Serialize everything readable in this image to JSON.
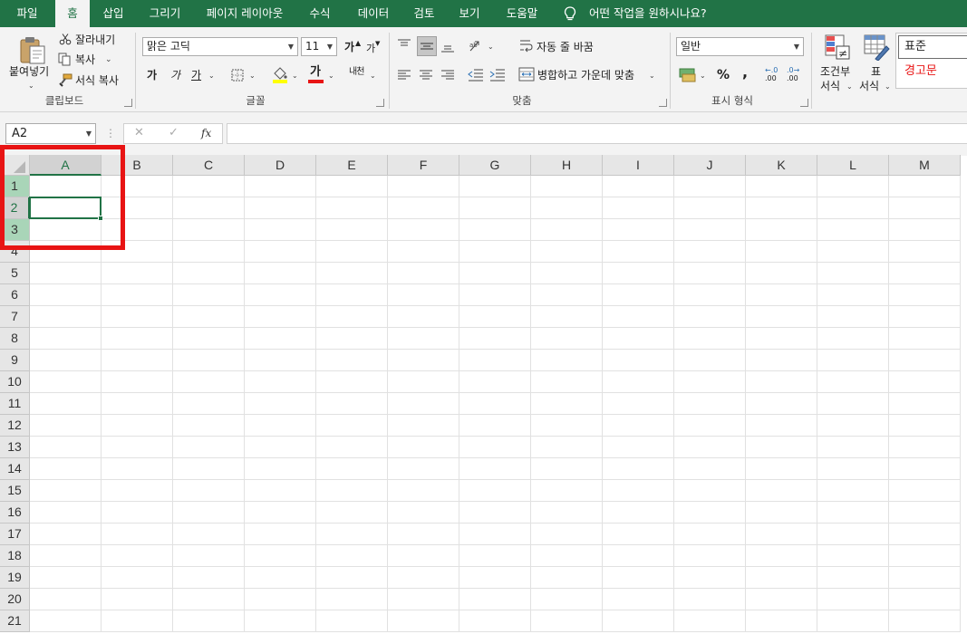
{
  "tabs": [
    "파일",
    "홈",
    "삽입",
    "그리기",
    "페이지 레이아웃",
    "수식",
    "데이터",
    "검토",
    "보기",
    "도움말"
  ],
  "active_tab": "홈",
  "tell_me": "어떤 작업을 원하시나요?",
  "clipboard": {
    "paste": "붙여넣기",
    "cut": "잘라내기",
    "copy": "복사",
    "format_painter": "서식 복사",
    "group": "클립보드"
  },
  "font": {
    "name": "맑은 고딕",
    "size": "11",
    "bold": "가",
    "italic": "가",
    "underline": "가",
    "font_color": "가",
    "phonetic": "내천",
    "grow": "가",
    "shrink": "가",
    "group": "글꼴"
  },
  "alignment": {
    "wrap": "자동 줄 바꿈",
    "merge": "병합하고 가운데 맞춤",
    "group": "맞춤"
  },
  "number": {
    "format": "일반",
    "percent": "%",
    "comma": ",",
    "inc_decimal": ".00",
    "dec_decimal": ".00",
    "group": "표시 형식"
  },
  "styles": {
    "cond1": "조건부",
    "cond2": "서식",
    "table1": "표",
    "table2": "서식",
    "normal": "표준",
    "warning": "경고문",
    "warning_color": "#e81414"
  },
  "formula_bar": {
    "name_box": "A2",
    "fx": "fx",
    "cancel": "✕",
    "enter": "✓"
  },
  "sheet": {
    "columns": [
      "A",
      "B",
      "C",
      "D",
      "E",
      "F",
      "G",
      "H",
      "I",
      "J",
      "K",
      "L",
      "M"
    ],
    "rows": [
      "1",
      "2",
      "3",
      "4",
      "5",
      "6",
      "7",
      "8",
      "9",
      "10",
      "11",
      "12",
      "13",
      "14",
      "15",
      "16",
      "17",
      "18",
      "19",
      "20",
      "21"
    ],
    "selected_cell": "A2"
  },
  "colors": {
    "accent": "#217346",
    "highlight": "#e81414"
  }
}
